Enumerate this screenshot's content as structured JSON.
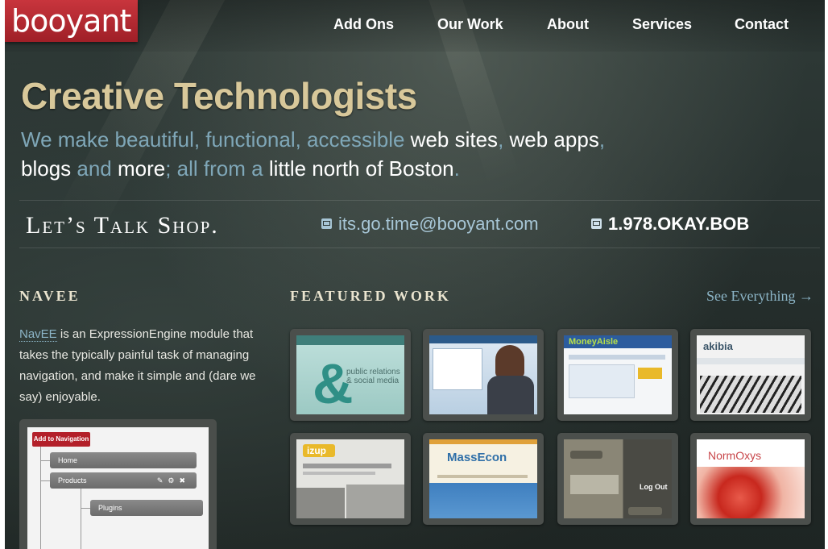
{
  "logo": {
    "text": "booyant"
  },
  "nav": [
    "Add Ons",
    "Our Work",
    "About",
    "Services",
    "Contact"
  ],
  "hero": {
    "headline": "Creative Technologists",
    "tagline": [
      {
        "text": "We make beautiful, functional, accessible ",
        "white": false
      },
      {
        "text": "web sites",
        "white": true
      },
      {
        "text": ", ",
        "white": false
      },
      {
        "text": "web apps",
        "white": true
      },
      {
        "text": ", ",
        "white": false
      },
      {
        "text": "blogs",
        "white": true
      },
      {
        "text": " and ",
        "white": false
      },
      {
        "text": "more",
        "white": true
      },
      {
        "text": "; all from a ",
        "white": false
      },
      {
        "text": "little north of Boston",
        "white": true
      },
      {
        "text": ".",
        "white": false
      }
    ]
  },
  "talk": {
    "heading": "Let’s Talk Shop.",
    "email": "its.go.time@booyant.com",
    "phone": "1.978.OKAY.BOB"
  },
  "navee": {
    "heading": "NAVEE",
    "link": "NavEE",
    "body": " is an ExpressionEngine module that takes the typically painful task of managing navigation, and make it simple and (dare we say) enjoyable.",
    "screenshot": {
      "button": "Add to Navigation",
      "items": [
        "Home",
        "Products",
        "Plugins"
      ]
    }
  },
  "featured": {
    "heading": "FEATURED WORK",
    "see_all": "See Everything →",
    "thumbs": [
      {
        "name": "thumb-1",
        "label": "public relations & social media"
      },
      {
        "name": "thumb-2",
        "label": ""
      },
      {
        "name": "thumb-3",
        "label": "MoneyAisle"
      },
      {
        "name": "thumb-4",
        "label": "akibia"
      },
      {
        "name": "thumb-5",
        "label": "izup"
      },
      {
        "name": "thumb-6",
        "label": "MassEcon"
      },
      {
        "name": "thumb-7",
        "label": "Log Out"
      },
      {
        "name": "thumb-8",
        "label": "NormOxys"
      }
    ]
  },
  "colors": {
    "logo_red": "#b3202a",
    "headline": "#d8c89a",
    "accent_blue": "#7fa7b8",
    "link_blue": "#8cb5c7"
  }
}
